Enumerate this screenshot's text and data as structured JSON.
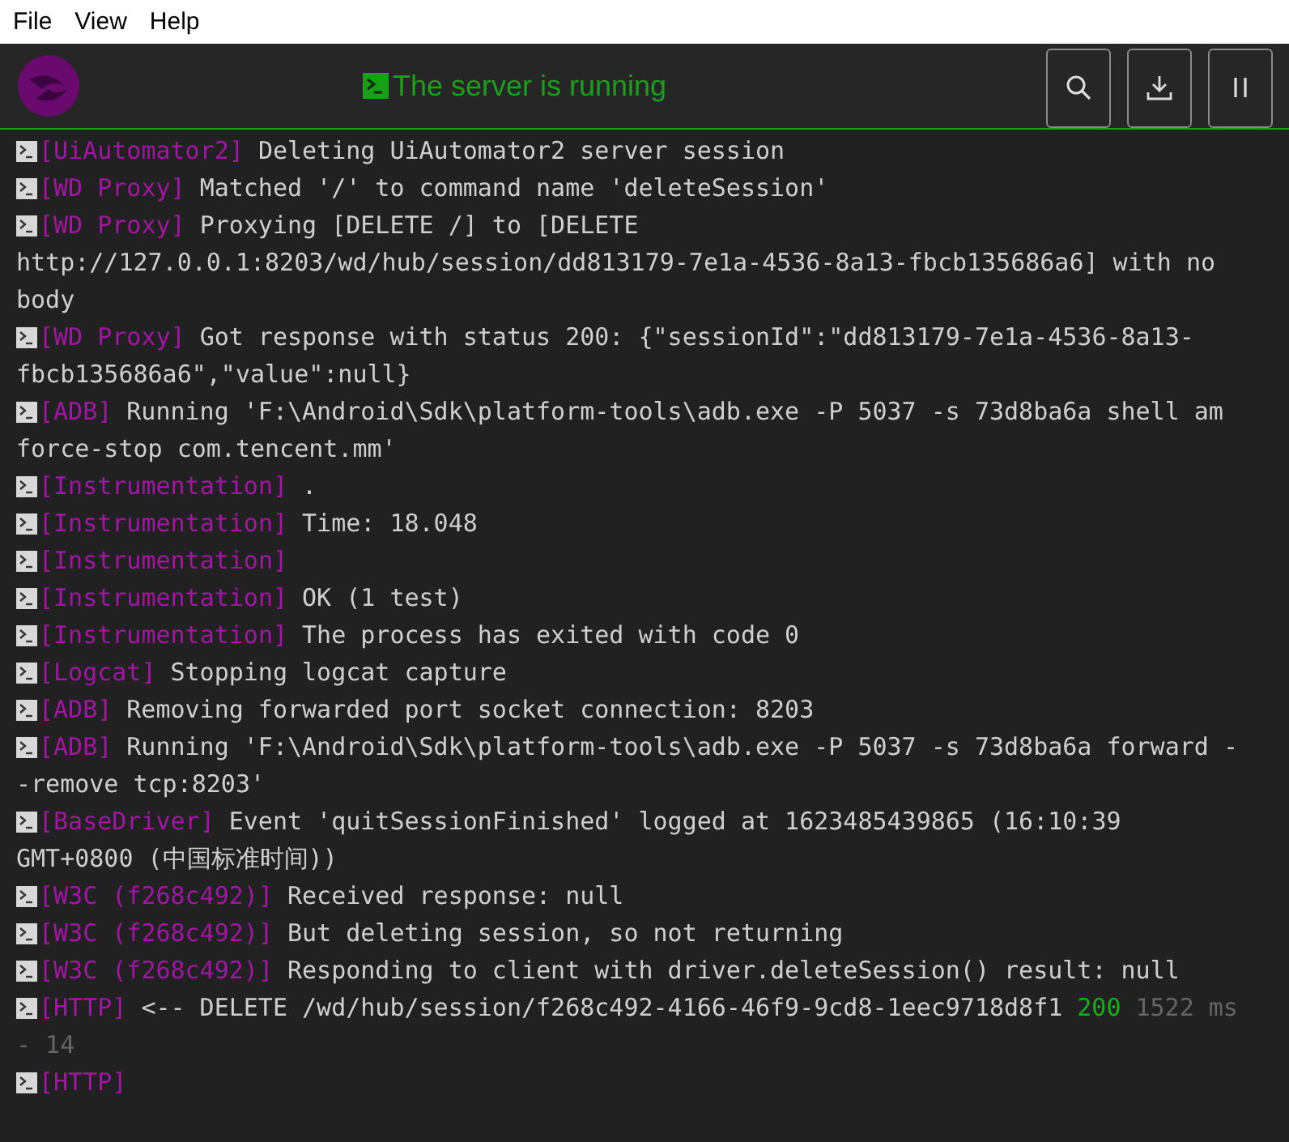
{
  "menu": [
    "File",
    "View",
    "Help"
  ],
  "header": {
    "status": "The server is running",
    "buttons": [
      {
        "kind": "search"
      },
      {
        "kind": "download"
      },
      {
        "kind": "pause"
      }
    ]
  },
  "log": [
    {
      "tag": "[UiAutomator2]",
      "lines": [
        [
          {
            "kind": "text",
            "text": "Deleting UiAutomator2 server session"
          }
        ]
      ]
    },
    {
      "tag": "[WD Proxy]",
      "lines": [
        [
          {
            "kind": "text",
            "text": "Matched '/' to command name 'deleteSession'"
          }
        ]
      ]
    },
    {
      "tag": "[WD Proxy]",
      "lines": [
        [
          {
            "kind": "text",
            "text": "Proxying [DELETE /] to [DELETE"
          }
        ],
        [
          {
            "kind": "text",
            "text": "http://127.0.0.1:8203/wd/hub/session/dd813179-7e1a-4536-8a13-fbcb135686a6] with no"
          }
        ],
        [
          {
            "kind": "text",
            "text": "body"
          }
        ]
      ]
    },
    {
      "tag": "[WD Proxy]",
      "lines": [
        [
          {
            "kind": "text",
            "text": "Got response with status 200: {\"sessionId\":\"dd813179-7e1a-4536-8a13-"
          }
        ],
        [
          {
            "kind": "text",
            "text": "fbcb135686a6\",\"value\":null}"
          }
        ]
      ]
    },
    {
      "tag": "[ADB]",
      "lines": [
        [
          {
            "kind": "text",
            "text": "Running 'F:\\Android\\Sdk\\platform-tools\\adb.exe -P 5037 -s 73d8ba6a shell am"
          }
        ],
        [
          {
            "kind": "text",
            "text": "force-stop com.tencent.mm'"
          }
        ]
      ]
    },
    {
      "tag": "[Instrumentation]",
      "lines": [
        [
          {
            "kind": "text",
            "text": "."
          }
        ]
      ]
    },
    {
      "tag": "[Instrumentation]",
      "lines": [
        [
          {
            "kind": "text",
            "text": "Time: 18.048"
          }
        ]
      ]
    },
    {
      "tag": "[Instrumentation]"
    },
    {
      "tag": "[Instrumentation]",
      "lines": [
        [
          {
            "kind": "text",
            "text": "OK (1 test)"
          }
        ]
      ]
    },
    {
      "tag": "[Instrumentation]",
      "lines": [
        [
          {
            "kind": "text",
            "text": "The process has exited with code 0"
          }
        ]
      ]
    },
    {
      "tag": "[Logcat]",
      "lines": [
        [
          {
            "kind": "text",
            "text": "Stopping logcat capture"
          }
        ]
      ]
    },
    {
      "tag": "[ADB]",
      "lines": [
        [
          {
            "kind": "text",
            "text": "Removing forwarded port socket connection: 8203"
          }
        ]
      ]
    },
    {
      "tag": "[ADB]",
      "lines": [
        [
          {
            "kind": "text",
            "text": "Running 'F:\\Android\\Sdk\\platform-tools\\adb.exe -P 5037 -s 73d8ba6a forward -"
          }
        ],
        [
          {
            "kind": "text",
            "text": "-remove tcp:8203'"
          }
        ]
      ]
    },
    {
      "tag": "[BaseDriver]",
      "lines": [
        [
          {
            "kind": "text",
            "text": "Event 'quitSessionFinished' logged at 1623485439865 (16:10:39"
          }
        ],
        [
          {
            "kind": "text",
            "text": "GMT+0800 (中国标准时间))"
          }
        ]
      ]
    },
    {
      "tag": "[W3C (f268c492)]",
      "lines": [
        [
          {
            "kind": "text",
            "text": "Received response: null"
          }
        ]
      ]
    },
    {
      "tag": "[W3C (f268c492)]",
      "lines": [
        [
          {
            "kind": "text",
            "text": "But deleting session, so not returning"
          }
        ]
      ]
    },
    {
      "tag": "[W3C (f268c492)]",
      "lines": [
        [
          {
            "kind": "text",
            "text": "Responding to client with driver.deleteSession() result: null"
          }
        ]
      ]
    },
    {
      "tag": "[HTTP]",
      "lines": [
        [
          {
            "kind": "text",
            "text": "<-- DELETE /wd/hub/session/f268c492-4166-46f9-9cd8-1eec9718d8f1"
          },
          {
            "kind": "status",
            "text": "200"
          },
          {
            "kind": "muted",
            "text": "1522 ms"
          }
        ],
        [
          {
            "kind": "muted",
            "text": "- 14"
          }
        ]
      ]
    },
    {
      "tag": "[HTTP]"
    }
  ]
}
